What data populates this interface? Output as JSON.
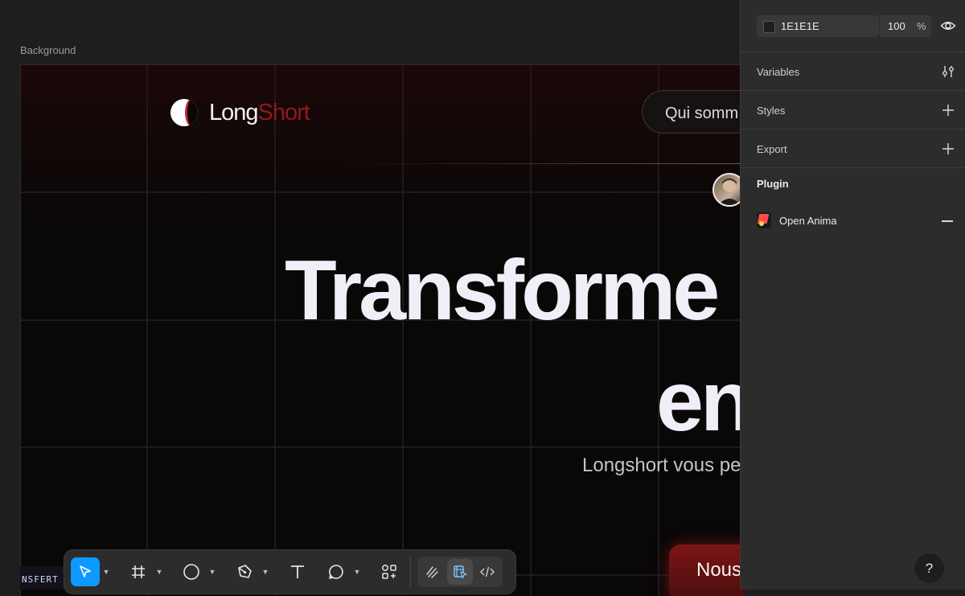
{
  "canvas": {
    "frame_label": "Background",
    "logo": {
      "text_main": "Long",
      "text_accent": "Short"
    },
    "nav_button": "Qui somm",
    "hero_line_1": "Transforme d",
    "hero_line_2": "en",
    "subtitle": "Longshort vous pe",
    "cta_button": "Nous",
    "strip_text": "NSFERT"
  },
  "toolbar": {
    "tools": [
      "move-tool",
      "frame-tool",
      "shape-tool",
      "pen-tool",
      "text-tool",
      "comment-tool",
      "actions-tool"
    ],
    "modes": [
      "draw-mode",
      "design-mode",
      "dev-mode"
    ],
    "active_tool": "move-tool",
    "active_mode": "design-mode"
  },
  "panel": {
    "fill": {
      "hex": "1E1E1E",
      "opacity": "100",
      "unit": "%"
    },
    "sections": [
      "Variables",
      "Styles",
      "Export"
    ],
    "plugin": {
      "title": "Plugin",
      "item": "Open Anima"
    },
    "help": "?"
  },
  "colors": {
    "canvas_bg": "#1E1E1E",
    "panel_bg": "#2C2C2C",
    "accent_blue": "#0D99FF",
    "brand_red": "#8E1A1D"
  }
}
